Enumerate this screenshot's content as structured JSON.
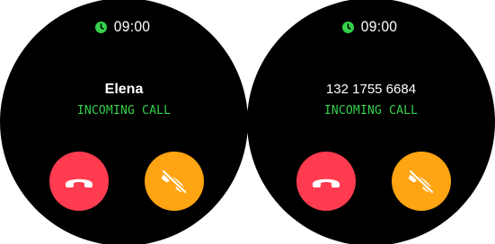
{
  "colors": {
    "background": "#000000",
    "accent_green": "#34d24a",
    "decline_red": "#ff3b50",
    "mute_orange": "#ffa412",
    "text_white": "#ffffff"
  },
  "screens": [
    {
      "status_bar": {
        "icon": "clock-icon",
        "time": "09:00"
      },
      "caller": "Elena",
      "call_status": "INCOMING CALL",
      "buttons": {
        "decline": {
          "icon": "phone-hangup-icon"
        },
        "mute": {
          "icon": "phone-muted-icon"
        }
      }
    },
    {
      "status_bar": {
        "icon": "clock-icon",
        "time": "09:00"
      },
      "caller": "132 1755 6684",
      "call_status": "INCOMING CALL",
      "buttons": {
        "decline": {
          "icon": "phone-hangup-icon"
        },
        "mute": {
          "icon": "phone-muted-icon"
        }
      }
    }
  ]
}
